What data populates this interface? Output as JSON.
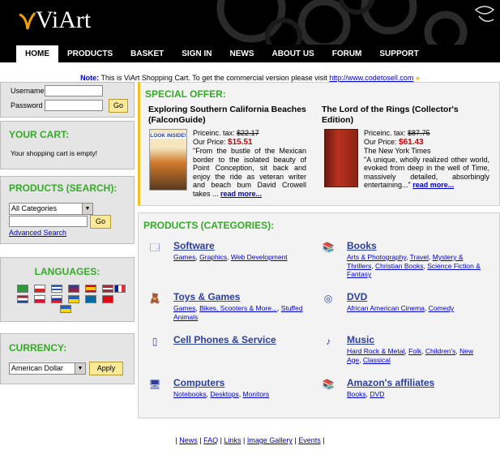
{
  "header": {
    "logo_text": "ViArt",
    "nav": [
      {
        "label": "HOME",
        "active": true
      },
      {
        "label": "PRODUCTS"
      },
      {
        "label": "BASKET"
      },
      {
        "label": "SIGN IN"
      },
      {
        "label": "NEWS"
      },
      {
        "label": "ABOUT US"
      },
      {
        "label": "FORUM"
      },
      {
        "label": "SUPPORT"
      }
    ]
  },
  "note": {
    "label": "Note:",
    "text": " This is ViArt Shopping Cart. To get the commercial version please visit ",
    "link": "http://www.codetosell.com",
    "arrows": "»"
  },
  "login": {
    "username_label": "Username",
    "password_label": "Password",
    "username_value": "",
    "password_value": "",
    "go_label": "Go"
  },
  "cart": {
    "title": "YOUR CART:",
    "message": "Your shopping cart is empty!"
  },
  "search": {
    "title": "PRODUCTS (SEARCH):",
    "category_selected": "All Categories",
    "query_value": "",
    "go_label": "Go",
    "advanced_link": "Advanced Search"
  },
  "languages": {
    "title": "LANGUAGES:",
    "flags": [
      "br",
      "cz",
      "gr",
      "gb",
      "es",
      "lv",
      "nl",
      "pl",
      "ru",
      "ua",
      "se",
      "tr",
      "fr",
      "ua2"
    ]
  },
  "currency": {
    "title": "CURRENCY:",
    "selected": "American Dollar",
    "apply_label": "Apply"
  },
  "special": {
    "title": "SPECIAL OFFER:",
    "products": [
      {
        "title": "Exploring Southern California Beaches (FalconGuide)",
        "price_label": "Priceinc. tax:",
        "old_price": "$22.17",
        "our_price_label": "Our Price:",
        "our_price": "$15.51",
        "author": "",
        "description": "\"From the bustle of the Mexican border to the isolated beauty of Point Conception, sit back and enjoy the ride as veteran writer and beach bum David Crowell takes ...",
        "more": "read more...",
        "cover_text": "LOOK INSIDE!"
      },
      {
        "title": "The Lord of the Rings (Collector's Edition)",
        "price_label": "Priceinc. tax:",
        "old_price": "$87.75",
        "our_price_label": "Our Price:",
        "our_price": "$61.43",
        "author": "The New York Times",
        "description": "\"A unique, wholly realized other world, evoked from deep in the well of Time, massively detailed, absorbingly entertaining...\"",
        "more": "read more..."
      }
    ]
  },
  "categories": {
    "title": "PRODUCTS (CATEGORIES):",
    "items": [
      {
        "name": "Software",
        "icon": "software-icon",
        "subs": [
          "Games",
          "Graphics",
          "Web Development"
        ]
      },
      {
        "name": "Books",
        "icon": "books-icon",
        "subs": [
          "Arts & Photography",
          "Travel",
          "Mystery & Thrillers",
          "Christian Books",
          "Science Fiction & Fantasy"
        ]
      },
      {
        "name": "Toys & Games",
        "icon": "toys-icon",
        "subs": [
          "Games",
          "Bikes, Scooters & More...",
          "Stuffed Animals"
        ]
      },
      {
        "name": "DVD",
        "icon": "dvd-icon",
        "subs": [
          "African American Cinema",
          "Comedy"
        ]
      },
      {
        "name": "Cell Phones & Service",
        "icon": "phone-icon",
        "subs": []
      },
      {
        "name": "Music",
        "icon": "music-icon",
        "subs": [
          "Hard Rock & Metal",
          "Folk",
          "Children's",
          "New Age",
          "Classical"
        ]
      },
      {
        "name": "Computers",
        "icon": "computer-icon",
        "subs": [
          "Notebooks",
          "Desktops",
          "Monitors"
        ]
      },
      {
        "name": "Amazon's affiliates",
        "icon": "amazon-icon",
        "subs": [
          "Books",
          "DVD"
        ]
      }
    ]
  },
  "footer": {
    "links": [
      "News",
      "FAQ",
      "Links",
      "Image Gallery",
      "Events"
    ]
  },
  "colors": {
    "header_bg": "#000000",
    "box_title": "#35aa26",
    "price_red": "#cc0000",
    "link_blue": "#0000cc",
    "button_yellow": "#fbe99a"
  }
}
